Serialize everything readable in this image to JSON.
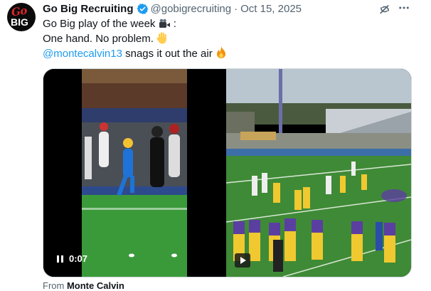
{
  "account": {
    "display_name": "Go Big Recruiting",
    "handle": "@gobigrecruiting",
    "separator": "·",
    "date": "Oct 15, 2025",
    "avatar_text_top": "Go",
    "avatar_text_bottom": "BIG",
    "verified": true
  },
  "post": {
    "line1": "Go Big play of the week",
    "line1_suffix": " :",
    "line2": "One hand. No problem. ",
    "mention": "@montecalvin13",
    "line3_rest": " snags it out the air ",
    "emojis": [
      "video-camera",
      "raised-hand",
      "fire"
    ]
  },
  "media": {
    "video_time": "0:07",
    "video_state": "paused"
  },
  "attribution": {
    "prefix": "From ",
    "name": "Monte Calvin"
  },
  "colors": {
    "link": "#1d9bf0",
    "verified": "#1d9bf0",
    "muted_text": "#536471",
    "avatar_red": "#e0242b"
  },
  "icons": {
    "verified": "verified-badge-icon",
    "grok": "grok-icon",
    "more": "more-options-icon",
    "pause": "pause-icon",
    "play": "play-icon"
  }
}
